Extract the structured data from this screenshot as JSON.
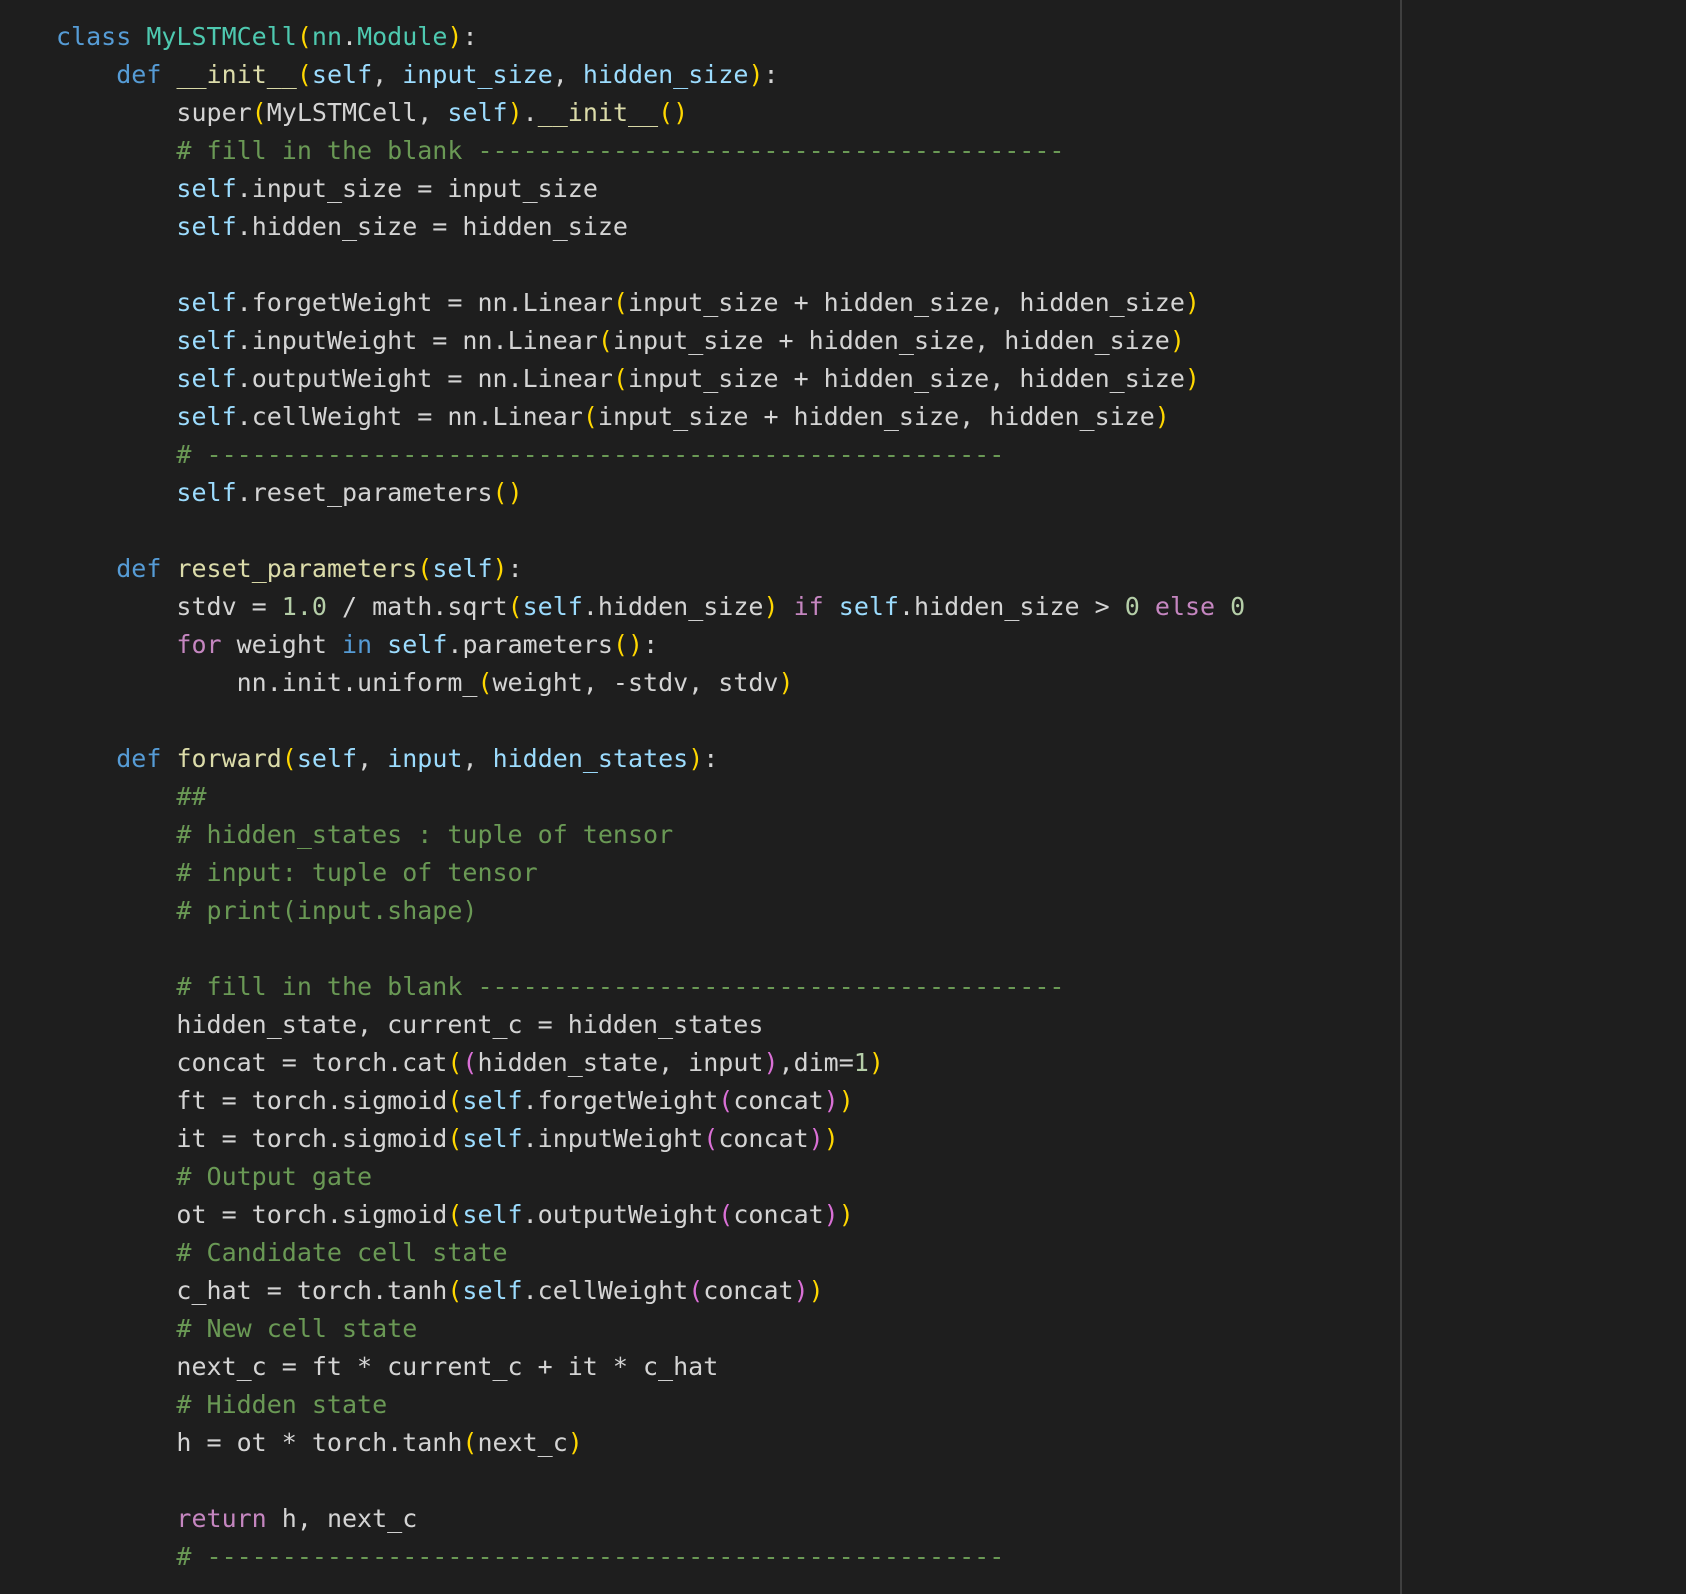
{
  "lines": [
    [
      [
        "k",
        "class"
      ],
      [
        "t",
        " "
      ],
      [
        "c",
        "MyLSTMCell"
      ],
      [
        "b1",
        "("
      ],
      [
        "c",
        "nn"
      ],
      [
        "t",
        "."
      ],
      [
        "c",
        "Module"
      ],
      [
        "b1",
        ")"
      ],
      [
        "t",
        ":"
      ]
    ],
    [
      [
        "t",
        "    "
      ],
      [
        "k",
        "def"
      ],
      [
        "t",
        " "
      ],
      [
        "f",
        "__init__"
      ],
      [
        "b1",
        "("
      ],
      [
        "s",
        "self"
      ],
      [
        "t",
        ", "
      ],
      [
        "p",
        "input_size"
      ],
      [
        "t",
        ", "
      ],
      [
        "p",
        "hidden_size"
      ],
      [
        "b1",
        ")"
      ],
      [
        "t",
        ":"
      ]
    ],
    [
      [
        "t",
        "        super"
      ],
      [
        "b1",
        "("
      ],
      [
        "t",
        "MyLSTMCell, "
      ],
      [
        "s",
        "self"
      ],
      [
        "b1",
        ")"
      ],
      [
        "t",
        "."
      ],
      [
        "f",
        "__init__"
      ],
      [
        "b1",
        "()"
      ]
    ],
    [
      [
        "t",
        "        "
      ],
      [
        "cm",
        "# fill in the blank ---------------------------------------"
      ]
    ],
    [
      [
        "t",
        "        "
      ],
      [
        "s",
        "self"
      ],
      [
        "t",
        ".input_size = input_size"
      ]
    ],
    [
      [
        "t",
        "        "
      ],
      [
        "s",
        "self"
      ],
      [
        "t",
        ".hidden_size = hidden_size"
      ]
    ],
    [],
    [
      [
        "t",
        "        "
      ],
      [
        "s",
        "self"
      ],
      [
        "t",
        ".forgetWeight = nn.Linear"
      ],
      [
        "b1",
        "("
      ],
      [
        "t",
        "input_size + hidden_size, hidden_size"
      ],
      [
        "b1",
        ")"
      ]
    ],
    [
      [
        "t",
        "        "
      ],
      [
        "s",
        "self"
      ],
      [
        "t",
        ".inputWeight = nn.Linear"
      ],
      [
        "b1",
        "("
      ],
      [
        "t",
        "input_size + hidden_size, hidden_size"
      ],
      [
        "b1",
        ")"
      ]
    ],
    [
      [
        "t",
        "        "
      ],
      [
        "s",
        "self"
      ],
      [
        "t",
        ".outputWeight = nn.Linear"
      ],
      [
        "b1",
        "("
      ],
      [
        "t",
        "input_size + hidden_size, hidden_size"
      ],
      [
        "b1",
        ")"
      ]
    ],
    [
      [
        "t",
        "        "
      ],
      [
        "s",
        "self"
      ],
      [
        "t",
        ".cellWeight = nn.Linear"
      ],
      [
        "b1",
        "("
      ],
      [
        "t",
        "input_size + hidden_size, hidden_size"
      ],
      [
        "b1",
        ")"
      ]
    ],
    [
      [
        "t",
        "        "
      ],
      [
        "cm",
        "# -----------------------------------------------------"
      ]
    ],
    [
      [
        "t",
        "        "
      ],
      [
        "s",
        "self"
      ],
      [
        "t",
        ".reset_parameters"
      ],
      [
        "b1",
        "()"
      ]
    ],
    [],
    [
      [
        "t",
        "    "
      ],
      [
        "k",
        "def"
      ],
      [
        "t",
        " "
      ],
      [
        "f",
        "reset_parameters"
      ],
      [
        "b1",
        "("
      ],
      [
        "s",
        "self"
      ],
      [
        "b1",
        ")"
      ],
      [
        "t",
        ":"
      ]
    ],
    [
      [
        "t",
        "        stdv = "
      ],
      [
        "n",
        "1.0"
      ],
      [
        "t",
        " / math.sqrt"
      ],
      [
        "b1",
        "("
      ],
      [
        "s",
        "self"
      ],
      [
        "t",
        ".hidden_size"
      ],
      [
        "b1",
        ")"
      ],
      [
        "t",
        " "
      ],
      [
        "kw",
        "if"
      ],
      [
        "t",
        " "
      ],
      [
        "s",
        "self"
      ],
      [
        "t",
        ".hidden_size > "
      ],
      [
        "n",
        "0"
      ],
      [
        "t",
        " "
      ],
      [
        "kw",
        "else"
      ],
      [
        "t",
        " "
      ],
      [
        "n",
        "0"
      ]
    ],
    [
      [
        "t",
        "        "
      ],
      [
        "kw",
        "for"
      ],
      [
        "t",
        " weight "
      ],
      [
        "k",
        "in"
      ],
      [
        "t",
        " "
      ],
      [
        "s",
        "self"
      ],
      [
        "t",
        ".parameters"
      ],
      [
        "b1",
        "()"
      ],
      [
        "t",
        ":"
      ]
    ],
    [
      [
        "t",
        "            nn.init.uniform_"
      ],
      [
        "b1",
        "("
      ],
      [
        "t",
        "weight, -stdv, stdv"
      ],
      [
        "b1",
        ")"
      ]
    ],
    [],
    [
      [
        "t",
        "    "
      ],
      [
        "k",
        "def"
      ],
      [
        "t",
        " "
      ],
      [
        "f",
        "forward"
      ],
      [
        "b1",
        "("
      ],
      [
        "s",
        "self"
      ],
      [
        "t",
        ", "
      ],
      [
        "p",
        "input"
      ],
      [
        "t",
        ", "
      ],
      [
        "p",
        "hidden_states"
      ],
      [
        "b1",
        ")"
      ],
      [
        "t",
        ":"
      ]
    ],
    [
      [
        "t",
        "        "
      ],
      [
        "cm",
        "##"
      ]
    ],
    [
      [
        "t",
        "        "
      ],
      [
        "cm",
        "# hidden_states : tuple of tensor"
      ]
    ],
    [
      [
        "t",
        "        "
      ],
      [
        "cm",
        "# input: tuple of tensor"
      ]
    ],
    [
      [
        "t",
        "        "
      ],
      [
        "cm",
        "# print(input.shape)"
      ]
    ],
    [],
    [
      [
        "t",
        "        "
      ],
      [
        "cm",
        "# fill in the blank ---------------------------------------"
      ]
    ],
    [
      [
        "t",
        "        hidden_state, current_c = hidden_states"
      ]
    ],
    [
      [
        "t",
        "        concat = torch.cat"
      ],
      [
        "b1",
        "("
      ],
      [
        "b2",
        "("
      ],
      [
        "t",
        "hidden_state, input"
      ],
      [
        "b2",
        ")"
      ],
      [
        "t",
        ",dim="
      ],
      [
        "n",
        "1"
      ],
      [
        "b1",
        ")"
      ]
    ],
    [
      [
        "t",
        "        ft = torch.sigmoid"
      ],
      [
        "b1",
        "("
      ],
      [
        "s",
        "self"
      ],
      [
        "t",
        ".forgetWeight"
      ],
      [
        "b2",
        "("
      ],
      [
        "t",
        "concat"
      ],
      [
        "b2",
        ")"
      ],
      [
        "b1",
        ")"
      ]
    ],
    [
      [
        "t",
        "        it = torch.sigmoid"
      ],
      [
        "b1",
        "("
      ],
      [
        "s",
        "self"
      ],
      [
        "t",
        ".inputWeight"
      ],
      [
        "b2",
        "("
      ],
      [
        "t",
        "concat"
      ],
      [
        "b2",
        ")"
      ],
      [
        "b1",
        ")"
      ]
    ],
    [
      [
        "t",
        "        "
      ],
      [
        "cm",
        "# Output gate"
      ]
    ],
    [
      [
        "t",
        "        ot = torch.sigmoid"
      ],
      [
        "b1",
        "("
      ],
      [
        "s",
        "self"
      ],
      [
        "t",
        ".outputWeight"
      ],
      [
        "b2",
        "("
      ],
      [
        "t",
        "concat"
      ],
      [
        "b2",
        ")"
      ],
      [
        "b1",
        ")"
      ]
    ],
    [
      [
        "t",
        "        "
      ],
      [
        "cm",
        "# Candidate cell state"
      ]
    ],
    [
      [
        "t",
        "        c_hat = torch.tanh"
      ],
      [
        "b1",
        "("
      ],
      [
        "s",
        "self"
      ],
      [
        "t",
        ".cellWeight"
      ],
      [
        "b2",
        "("
      ],
      [
        "t",
        "concat"
      ],
      [
        "b2",
        ")"
      ],
      [
        "b1",
        ")"
      ]
    ],
    [
      [
        "t",
        "        "
      ],
      [
        "cm",
        "# New cell state"
      ]
    ],
    [
      [
        "t",
        "        next_c = ft * current_c + it * c_hat"
      ]
    ],
    [
      [
        "t",
        "        "
      ],
      [
        "cm",
        "# Hidden state"
      ]
    ],
    [
      [
        "t",
        "        h = ot * torch.tanh"
      ],
      [
        "b1",
        "("
      ],
      [
        "t",
        "next_c"
      ],
      [
        "b1",
        ")"
      ]
    ],
    [],
    [
      [
        "t",
        "        "
      ],
      [
        "kw",
        "return"
      ],
      [
        "t",
        " h, next_c"
      ]
    ],
    [
      [
        "t",
        "        "
      ],
      [
        "cm",
        "# -----------------------------------------------------"
      ]
    ]
  ],
  "colors": {
    "background": "#1e1e1e",
    "default": "#d4d4d4",
    "keyword": "#569cd6",
    "class": "#4ec9b0",
    "function": "#dcdcaa",
    "variable": "#9cdcfe",
    "comment": "#6a9955",
    "number": "#b5cea8",
    "bracket_1": "#ffd700",
    "bracket_2": "#da70d6",
    "control_keyword": "#c586c0"
  }
}
